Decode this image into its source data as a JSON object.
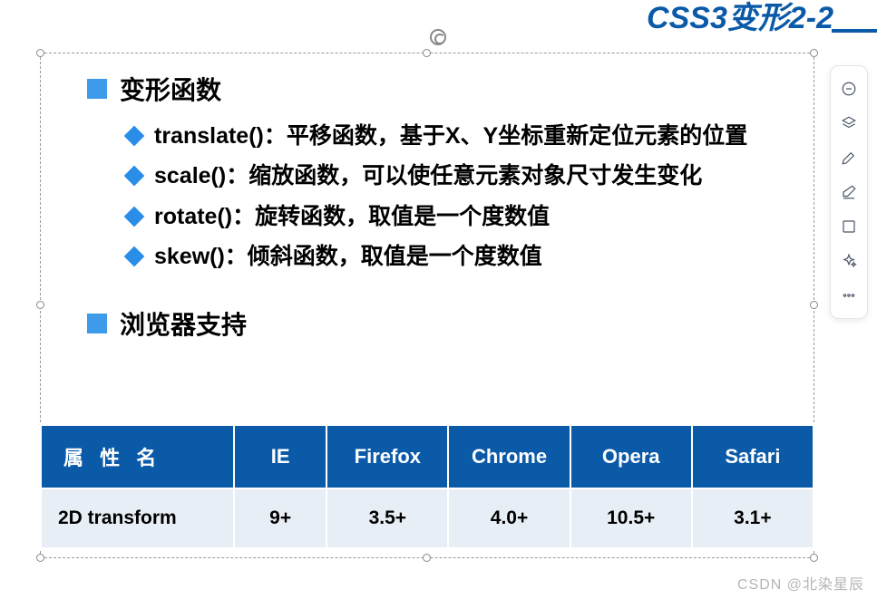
{
  "page_title": "CSS3变形2-2",
  "sections": {
    "transform_functions": {
      "title": "变形函数",
      "items": [
        "translate()：平移函数，基于X、Y坐标重新定位元素的位置",
        "scale()：缩放函数，可以使任意元素对象尺寸发生变化",
        "rotate()：旋转函数，取值是一个度数值",
        "skew()：倾斜函数，取值是一个度数值"
      ]
    },
    "browser_support": {
      "title": "浏览器支持"
    }
  },
  "chart_data": {
    "type": "table",
    "headers": [
      "属 性 名",
      "IE",
      "Firefox",
      "Chrome",
      "Opera",
      "Safari"
    ],
    "rows": [
      [
        "2D transform",
        "9+",
        "3.5+",
        "4.0+",
        "10.5+",
        "3.1+"
      ]
    ]
  },
  "toolbar": {
    "zoom_out": "缩小",
    "layers": "图层",
    "brush": "画笔",
    "eraser": "橡皮",
    "frame": "框选",
    "magic": "魔法",
    "more": "更多"
  },
  "watermark": "CSDN @北染星辰"
}
